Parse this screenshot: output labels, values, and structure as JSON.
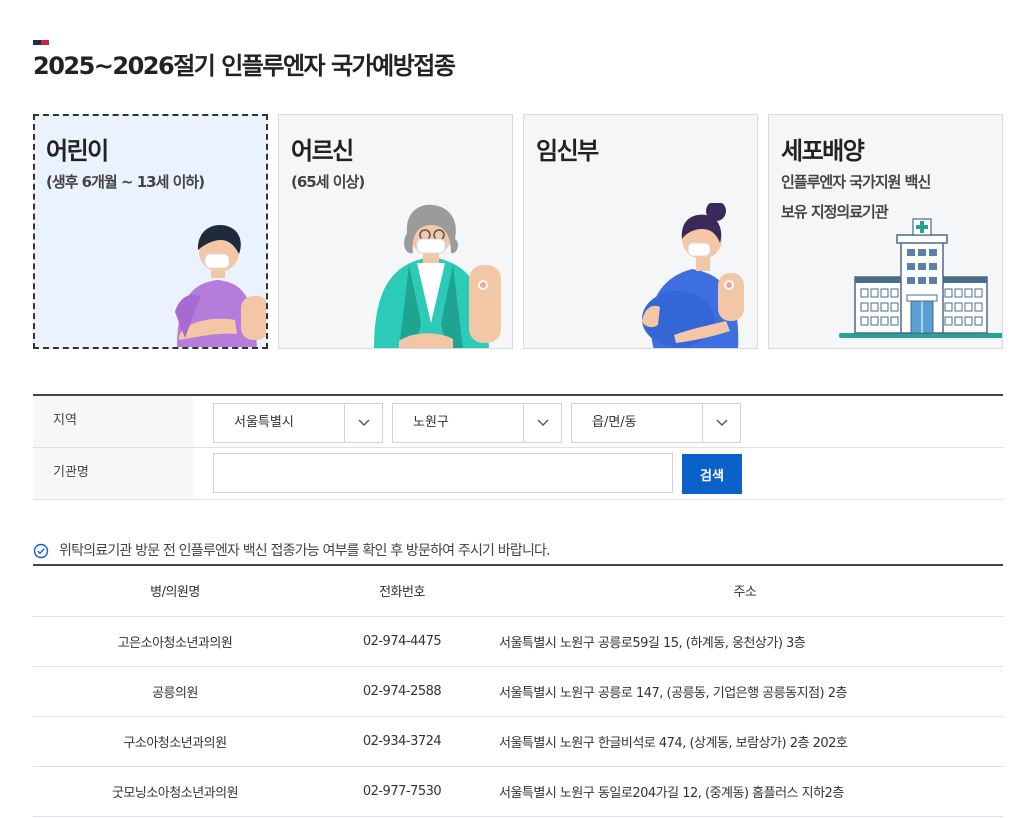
{
  "page": {
    "title": "2025~2026절기 인플루엔자 국가예방접종"
  },
  "categories": [
    {
      "title": "어린이",
      "subtitle": "(생후 6개월 ~ 13세 이하)",
      "selected": true
    },
    {
      "title": "어르신",
      "subtitle": "(65세 이상)",
      "selected": false
    },
    {
      "title": "임신부",
      "subtitle": "",
      "selected": false
    },
    {
      "title": "세포배양",
      "subtitle": "인플루엔자 국가지원 백신",
      "subtitle2": "보유 지정의료기관",
      "selected": false
    }
  ],
  "search": {
    "region_label": "지역",
    "sido": "서울특별시",
    "sigungu": "노원구",
    "dong": "읍/면/동",
    "org_label": "기관명",
    "org_value": "",
    "org_placeholder": "",
    "button_label": "검색"
  },
  "notice": {
    "text": "위탁의료기관 방문 전 인플루엔자 백신 접종가능 여부를 확인 후 방문하여 주시기 바랍니다."
  },
  "table": {
    "headers": {
      "name": "병/의원명",
      "phone": "전화번호",
      "address": "주소"
    },
    "rows": [
      {
        "name": "고은소아청소년과의원",
        "phone": "02-974-4475",
        "address": "서울특별시 노원구 공릉로59길 15, (하계동, 웅천상가) 3층"
      },
      {
        "name": "공릉의원",
        "phone": "02-974-2588",
        "address": "서울특별시 노원구 공릉로 147, (공릉동, 기업은행 공릉동지점) 2층"
      },
      {
        "name": "구소아청소년과의원",
        "phone": "02-934-3724",
        "address": "서울특별시 노원구 한글비석로 474, (상계동, 보람상가) 2층 202호"
      },
      {
        "name": "굿모닝소아청소년과의원",
        "phone": "02-977-7530",
        "address": "서울특별시 노원구 동일로204가길 12, (중계동) 홈플러스 지하2층"
      }
    ]
  },
  "colors": {
    "accent": "#0a62c9",
    "selected_card_bg": "#eaf3fd",
    "card_bg": "#f5f6f8",
    "mark_navy": "#1a2b5c",
    "mark_red": "#d0213a"
  },
  "icons": {
    "title_mark": "title-mark-icon",
    "notice": "check-circle-icon",
    "select_arrow": "chevron-down-icon"
  }
}
